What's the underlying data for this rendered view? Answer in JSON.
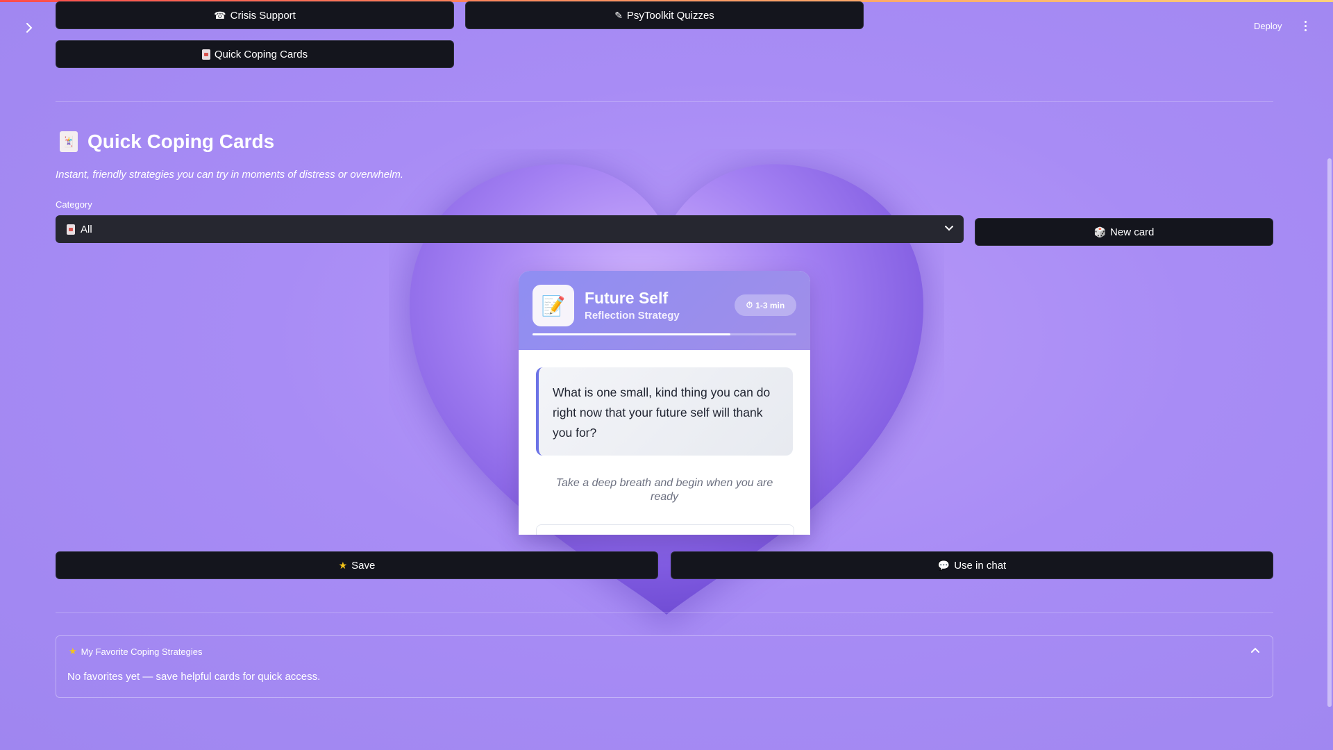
{
  "app": {
    "deploy_label": "Deploy"
  },
  "nav": {
    "crisis_support_label": "Crisis Support",
    "psytoolkit_label": "PsyToolkit Quizzes",
    "quick_coping_label": "Quick Coping Cards"
  },
  "page": {
    "title": "Quick Coping Cards",
    "subtitle": "Instant, friendly strategies you can try in moments of distress or overwhelm."
  },
  "category": {
    "label": "Category",
    "selected": "All"
  },
  "actions": {
    "new_card_label": "New card",
    "save_label": "Save",
    "use_in_chat_label": "Use in chat"
  },
  "card": {
    "icon": "memo-pencil-icon",
    "title": "Future Self",
    "subtitle": "Reflection Strategy",
    "duration": "1-3 min",
    "progress_fraction": 0.75,
    "prompt": "What is one small, kind thing you can do right now that your future self will thank you for?",
    "hint": "Take a deep breath and begin when you are ready"
  },
  "favorites": {
    "header": "My Favorite Coping Strategies",
    "empty_message": "No favorites yet — save helpful cards for quick access."
  },
  "colors": {
    "button_bg": "#14151d",
    "page_bg": "#a88cf5",
    "card_header": "#8f8ef2",
    "accent_border": "#6b72e6"
  }
}
